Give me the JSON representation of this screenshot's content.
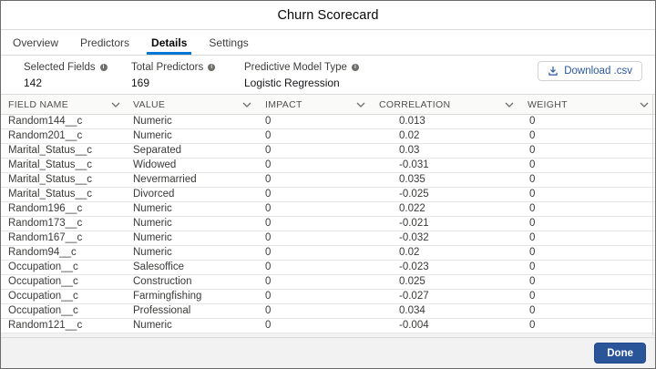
{
  "window": {
    "title": "Churn Scorecard"
  },
  "tabs": [
    {
      "label": "Overview",
      "active": false
    },
    {
      "label": "Predictors",
      "active": false
    },
    {
      "label": "Details",
      "active": true
    },
    {
      "label": "Settings",
      "active": false
    }
  ],
  "summary": {
    "items": [
      {
        "label": "Selected Fields",
        "value": "142"
      },
      {
        "label": "Total Predictors",
        "value": "169"
      },
      {
        "label": "Predictive Model Type",
        "value": "Logistic Regression"
      }
    ],
    "download_button": "Download .csv"
  },
  "table": {
    "columns": [
      "FIELD NAME",
      "VALUE",
      "IMPACT",
      "CORRELATION",
      "WEIGHT"
    ],
    "rows": [
      {
        "field": "Random144__c",
        "value": "Numeric",
        "impact": "0",
        "correlation": "0.013",
        "weight": "0"
      },
      {
        "field": "Random201__c",
        "value": "Numeric",
        "impact": "0",
        "correlation": "0.02",
        "weight": "0"
      },
      {
        "field": "Marital_Status__c",
        "value": "Separated",
        "impact": "0",
        "correlation": "0.03",
        "weight": "0"
      },
      {
        "field": "Marital_Status__c",
        "value": "Widowed",
        "impact": "0",
        "correlation": "-0.031",
        "weight": "0"
      },
      {
        "field": "Marital_Status__c",
        "value": "Nevermarried",
        "impact": "0",
        "correlation": "0.035",
        "weight": "0"
      },
      {
        "field": "Marital_Status__c",
        "value": "Divorced",
        "impact": "0",
        "correlation": "-0.025",
        "weight": "0"
      },
      {
        "field": "Random196__c",
        "value": "Numeric",
        "impact": "0",
        "correlation": "0.022",
        "weight": "0"
      },
      {
        "field": "Random173__c",
        "value": "Numeric",
        "impact": "0",
        "correlation": "-0.021",
        "weight": "0"
      },
      {
        "field": "Random167__c",
        "value": "Numeric",
        "impact": "0",
        "correlation": "-0.032",
        "weight": "0"
      },
      {
        "field": "Random94__c",
        "value": "Numeric",
        "impact": "0",
        "correlation": "0.02",
        "weight": "0"
      },
      {
        "field": "Occupation__c",
        "value": "Salesoffice",
        "impact": "0",
        "correlation": "-0.023",
        "weight": "0"
      },
      {
        "field": "Occupation__c",
        "value": "Construction",
        "impact": "0",
        "correlation": "0.025",
        "weight": "0"
      },
      {
        "field": "Occupation__c",
        "value": "Farmingfishing",
        "impact": "0",
        "correlation": "-0.027",
        "weight": "0"
      },
      {
        "field": "Occupation__c",
        "value": "Professional",
        "impact": "0",
        "correlation": "0.034",
        "weight": "0"
      },
      {
        "field": "Random121__c",
        "value": "Numeric",
        "impact": "0",
        "correlation": "-0.004",
        "weight": "0"
      }
    ]
  },
  "footer": {
    "done_button": "Done"
  },
  "icons": {
    "info": "info-icon",
    "download": "download-icon",
    "sort": "chevron-down-icon"
  },
  "colors": {
    "tab_underline": "#0176d3",
    "primary_button": "#2a5699",
    "link_blue": "#2a5699",
    "header_text": "#514f4d",
    "border": "#dddbda",
    "header_bg": "#fafaf9",
    "footer_bg": "#f3f2f2"
  }
}
